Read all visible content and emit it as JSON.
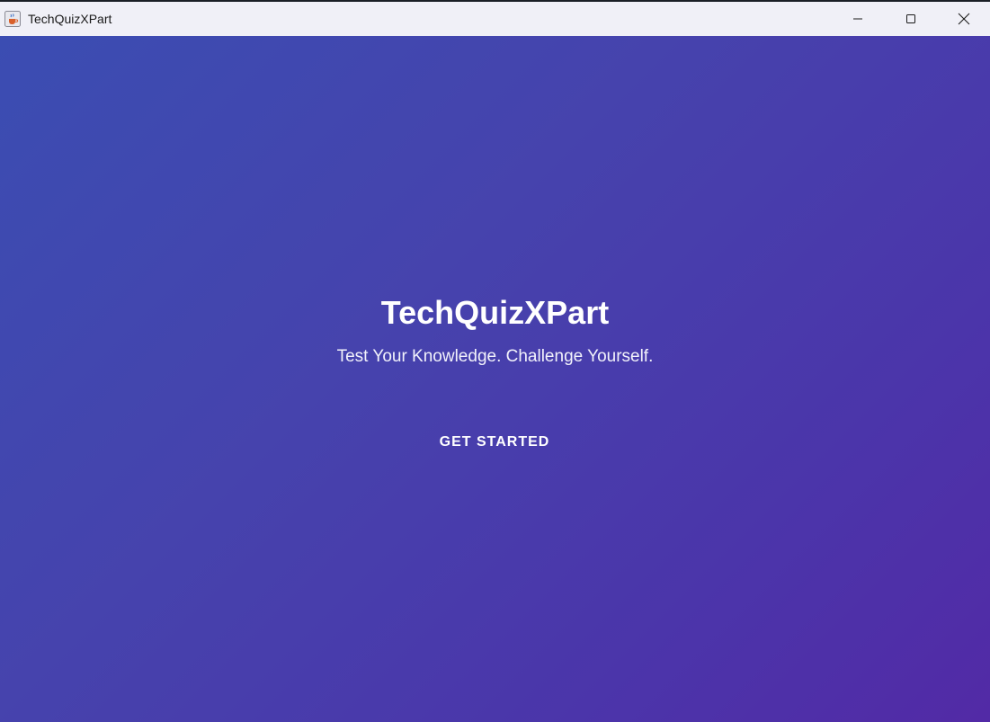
{
  "window": {
    "title": "TechQuizXPart",
    "icon": "java-cup-icon"
  },
  "controls": {
    "minimize_icon": "minimize-icon",
    "maximize_icon": "maximize-icon",
    "close_icon": "close-icon"
  },
  "main": {
    "title": "TechQuizXPart",
    "subtitle": "Test Your Knowledge. Challenge Yourself.",
    "start_button": "GET STARTED"
  },
  "colors": {
    "gradient_start": "#3b4db2",
    "gradient_end": "#522aa6",
    "titlebar": "#f0f0f7",
    "text": "#ffffff"
  }
}
